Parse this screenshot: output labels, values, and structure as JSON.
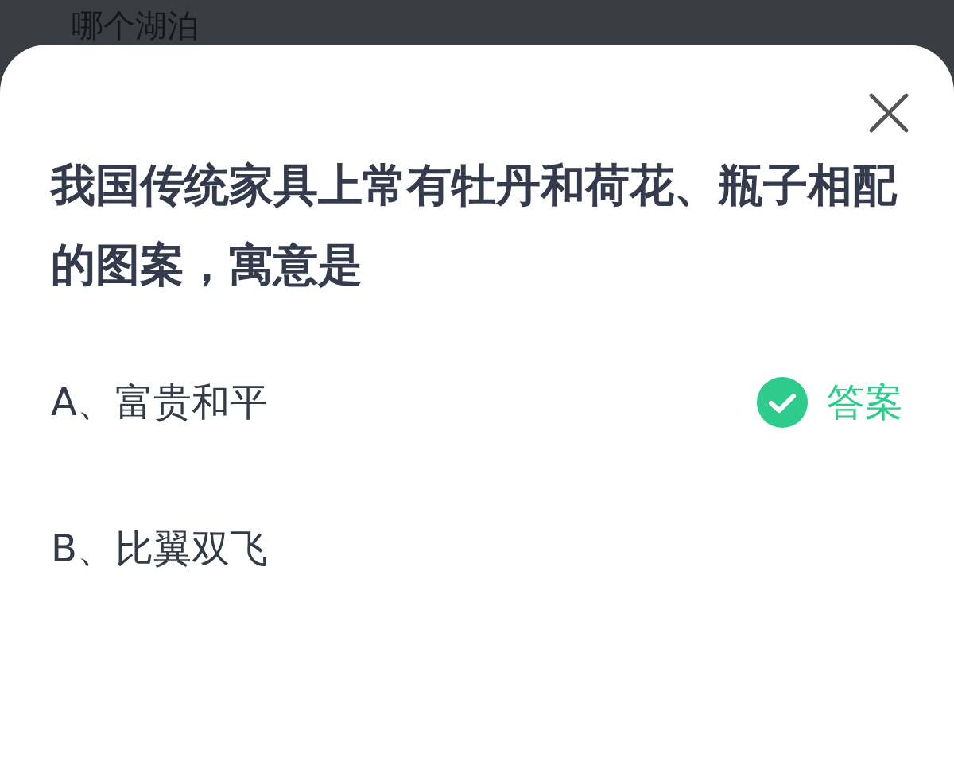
{
  "background_title": "哪个湖泊",
  "question": "我国传统家具上常有牡丹和荷花、瓶子相配的图案，寓意是",
  "options": [
    {
      "label": "A、富贵和平",
      "correct": true,
      "answer_tag": "答案"
    },
    {
      "label": "B、比翼双飞",
      "correct": false
    }
  ]
}
